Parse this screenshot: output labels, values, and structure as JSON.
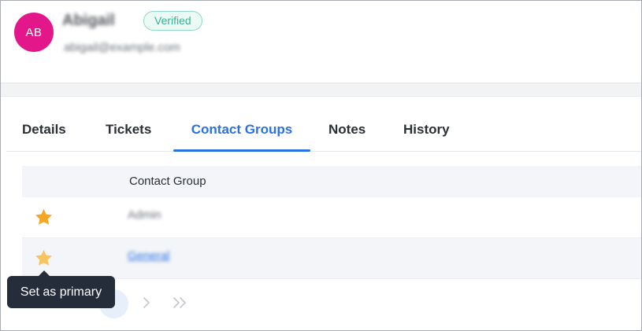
{
  "contact": {
    "initials": "AB",
    "name": "Abigail",
    "email": "abigail@example.com",
    "status_badge": "Verified"
  },
  "tabs": [
    {
      "label": "Details",
      "active": false
    },
    {
      "label": "Tickets",
      "active": false
    },
    {
      "label": "Contact Groups",
      "active": true
    },
    {
      "label": "Notes",
      "active": false
    },
    {
      "label": "History",
      "active": false
    }
  ],
  "table": {
    "column_header": "Contact Group",
    "rows": [
      {
        "name": "Admin",
        "primary": true,
        "star_color": "#f5a623"
      },
      {
        "name": "General",
        "primary": false,
        "star_color": "#f8c462"
      }
    ]
  },
  "pagination": {
    "icons": [
      "page-indicator",
      "chevron-right-icon",
      "double-chevron-right-icon"
    ]
  },
  "tooltip": {
    "text": "Set as primary"
  },
  "colors": {
    "accent": "#2b71e2",
    "avatar": "#e3178a",
    "verified_text": "#36b394",
    "tooltip_bg": "#262d3a"
  }
}
